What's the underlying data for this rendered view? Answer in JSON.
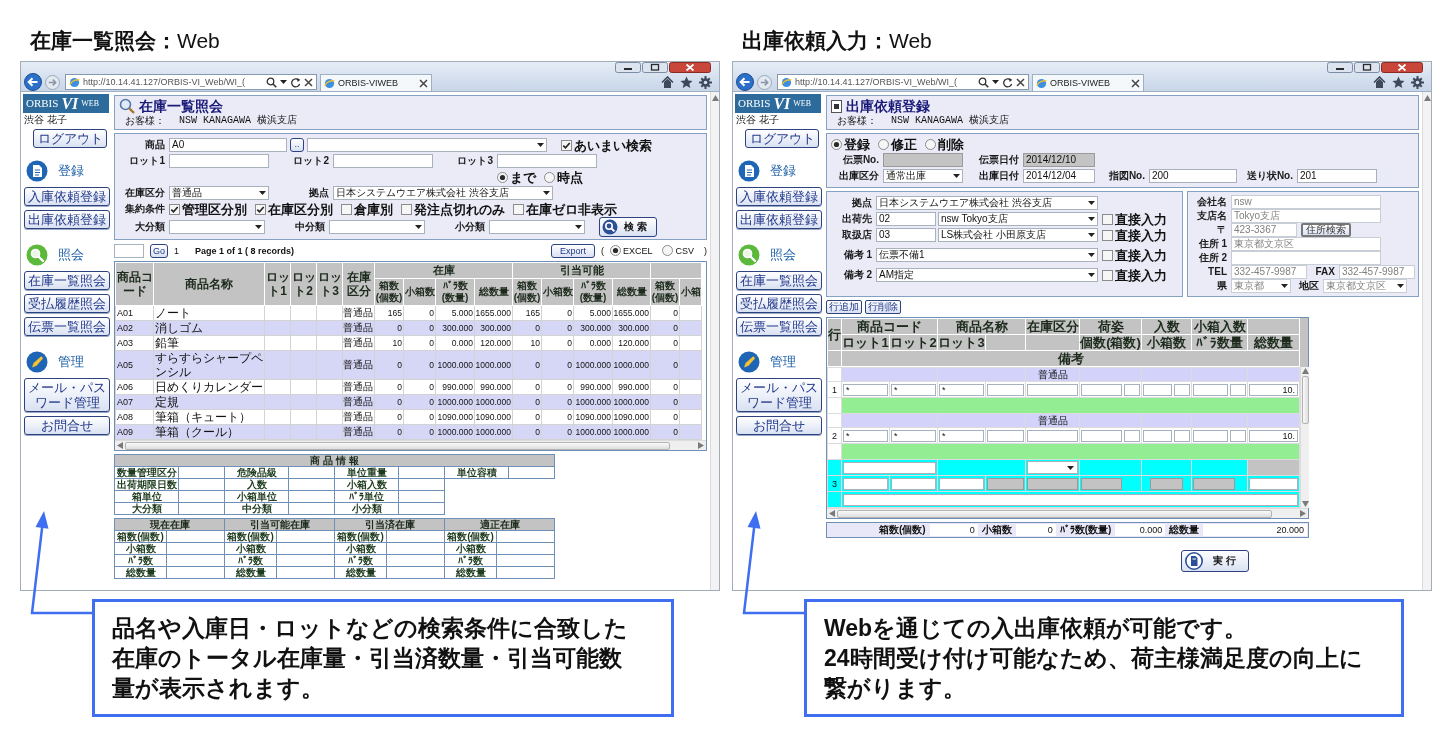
{
  "sections": [
    {
      "kind": "stock_inquiry",
      "heading": "**在庫一覧照会：**Web",
      "browser": {
        "address": "http://10.14.41.127/ORBIS-VI_Web/WI_(",
        "tab": "ORBIS-VIWEB"
      },
      "sidebar": {
        "logo": {
          "name": "ORBIS",
          "mark": "VI",
          "suffix": "WEB"
        },
        "user": "渋谷 花子",
        "logout": "ログアウト",
        "groups": [
          {
            "title": "登録",
            "items": [
              "入庫依頼登録",
              "出庫依頼登録"
            ]
          },
          {
            "title": "照会",
            "items": [
              "在庫一覧照会",
              "受払履歴照会",
              "伝票一覧照会"
            ]
          },
          {
            "title": "管理",
            "items": [
              "メール・パスワード管理",
              "お問合せ"
            ]
          }
        ]
      },
      "app": {
        "title": "在庫一覧照会",
        "customer_label": "お客様：",
        "customer": "NSW KANAGAWA 横浜支店",
        "search": {
          "product": {
            "label": "商品",
            "value": "A0",
            "lookup": ".."
          },
          "fuzzy": {
            "label": "あいまい検索",
            "checked": true
          },
          "lots": [
            "ロット1",
            "ロット2",
            "ロット3"
          ],
          "date_modes": [
            {
              "label": "まで",
              "selected": true
            },
            {
              "label": "時点",
              "selected": false
            }
          ],
          "stock_type": {
            "label": "在庫区分",
            "value": "普通品"
          },
          "site": {
            "label": "拠点",
            "value": "日本システムウエア株式会社 渋谷支店"
          },
          "grouping": {
            "label": "集約条件",
            "options": [
              {
                "label": "管理区分別",
                "checked": true
              },
              {
                "label": "在庫区分別",
                "checked": true
              },
              {
                "label": "倉庫別",
                "checked": false
              },
              {
                "label": "発注点切れのみ",
                "checked": false
              },
              {
                "label": "在庫ゼロ非表示",
                "checked": false
              }
            ]
          },
          "categories": [
            "大分類",
            "中分類",
            "小分類"
          ],
          "button": "検 索"
        },
        "pager": {
          "go": "Go",
          "page": "1",
          "summary": "Page 1 of 1 ( 8 records)",
          "export": "Export",
          "open": "(",
          "formats": [
            {
              "label": "EXCEL",
              "selected": true
            },
            {
              "label": "CSV",
              "selected": false
            }
          ],
          "close": ")"
        },
        "table": {
          "columns": [
            "商品コード",
            "商品名称",
            "ロット1",
            "ロット2",
            "ロット3",
            "在庫区分"
          ],
          "groups": [
            {
              "title": "在庫",
              "columns": [
                "箱数(個数)",
                "小箱数",
                "ﾊﾞﾗ数(数量)",
                "総数量"
              ]
            },
            {
              "title": "引当可能",
              "columns": [
                "箱数(個数)",
                "小箱数",
                "ﾊﾞﾗ数(数量)",
                "総数量"
              ]
            },
            {
              "columns": [
                "箱数(個数)",
                "小箱"
              ]
            }
          ],
          "rows": [
            {
              "code": "A01",
              "name": "ノート",
              "type": "普通品",
              "values": [
                "165",
                "0",
                "5.000",
                "1655.000",
                "165",
                "0",
                "5.000",
                "1655.000",
                "0"
              ]
            },
            {
              "code": "A02",
              "name": "消しゴム",
              "type": "普通品",
              "values": [
                "0",
                "0",
                "300.000",
                "300.000",
                "0",
                "0",
                "300.000",
                "300.000",
                "0"
              ]
            },
            {
              "code": "A03",
              "name": "鉛筆",
              "type": "普通品",
              "values": [
                "10",
                "0",
                "0.000",
                "120.000",
                "10",
                "0",
                "0.000",
                "120.000",
                "0"
              ]
            },
            {
              "code": "A05",
              "name": "すらすらシャープペンシル",
              "type": "普通品",
              "values": [
                "0",
                "0",
                "1000.000",
                "1000.000",
                "0",
                "0",
                "1000.000",
                "1000.000",
                "0"
              ]
            },
            {
              "code": "A06",
              "name": "日めくりカレンダー",
              "type": "普通品",
              "values": [
                "0",
                "0",
                "990.000",
                "990.000",
                "0",
                "0",
                "990.000",
                "990.000",
                "0"
              ]
            },
            {
              "code": "A07",
              "name": "定規",
              "type": "普通品",
              "values": [
                "0",
                "0",
                "1000.000",
                "1000.000",
                "0",
                "0",
                "1000.000",
                "1000.000",
                "0"
              ]
            },
            {
              "code": "A08",
              "name": "筆箱（キュート）",
              "type": "普通品",
              "values": [
                "0",
                "0",
                "1090.000",
                "1090.000",
                "0",
                "0",
                "1090.000",
                "1090.000",
                "0"
              ]
            },
            {
              "code": "A09",
              "name": "筆箱（クール）",
              "type": "普通品",
              "values": [
                "0",
                "0",
                "1000.000",
                "1000.000",
                "0",
                "0",
                "1000.000",
                "1000.000",
                "0"
              ]
            }
          ]
        },
        "product_info": {
          "title": "商 品 情 報",
          "rows": [
            [
              "数量管理区分",
              "危険品級",
              "単位重量",
              "単位容積"
            ],
            [
              "出荷期限日数",
              "入数",
              "小箱入数"
            ],
            [
              "箱単位",
              "小箱単位",
              "ﾊﾞﾗ単位"
            ],
            [
              "大分類",
              "中分類",
              "小分類"
            ]
          ]
        },
        "stock_summary": [
          {
            "title": "現在在庫",
            "rows": [
              "箱数(個数)",
              "小箱数",
              "ﾊﾞﾗ数",
              "総数量"
            ]
          },
          {
            "title": "引当可能在庫",
            "rows": [
              "箱数(個数)",
              "小箱数",
              "ﾊﾞﾗ数",
              "総数量"
            ]
          },
          {
            "title": "引当済在庫",
            "rows": [
              "箱数(個数)",
              "小箱数",
              "ﾊﾞﾗ数",
              "総数量"
            ]
          },
          {
            "title": "適正在庫",
            "rows": [
              "箱数(個数)",
              "小箱数",
              "ﾊﾞﾗ数",
              "総数量"
            ]
          }
        ]
      },
      "callout": {
        "paragraphs": [
          "品名や入庫日・ロットなどの検索条件に合致した在庫のトータル在庫量・引当済数量・引当可能数量が表示されます。"
        ]
      }
    },
    {
      "kind": "shipping_request",
      "heading": "**出庫依頼入力：**Web",
      "browser": {
        "address": "http://10.14.41.127/ORBIS-VI_Web/WI_(",
        "tab": "ORBIS-VIWEB"
      },
      "sidebar": {
        "logo": {
          "name": "ORBIS",
          "mark": "VI",
          "suffix": "WEB"
        },
        "user": "渋谷 花子",
        "logout": "ログアウト",
        "groups": [
          {
            "title": "登録",
            "items": [
              "入庫依頼登録",
              "出庫依頼登録"
            ]
          },
          {
            "title": "照会",
            "items": [
              "在庫一覧照会",
              "受払履歴照会",
              "伝票一覧照会"
            ]
          },
          {
            "title": "管理",
            "items": [
              "メール・パスワード管理",
              "お問合せ"
            ]
          }
        ]
      },
      "app": {
        "title": "出庫依頼登録",
        "customer_label": "お客様：",
        "customer": "NSW KANAGAWA 横浜支店",
        "modes": [
          {
            "label": "登録",
            "selected": true
          },
          {
            "label": "修正",
            "selected": false
          },
          {
            "label": "削除",
            "selected": false
          }
        ],
        "header_rows": [
          [
            {
              "label": "伝票No.",
              "kind": "input",
              "readonly": true
            },
            {
              "label": "伝票日付",
              "kind": "input",
              "value": "2014/12/10",
              "readonly": true
            }
          ],
          [
            {
              "label": "出庫区分",
              "kind": "select",
              "value": "通常出庫",
              "readonly": false
            },
            {
              "label": "出庫日付",
              "kind": "input",
              "value": "2014/12/04",
              "readonly": false
            },
            {
              "label": "指図No.",
              "kind": "input",
              "value": "200",
              "readonly": false
            },
            {
              "label": "送り状No.",
              "kind": "input",
              "value": "201",
              "readonly": false
            }
          ]
        ],
        "delivery": {
          "site": {
            "label": "拠点",
            "value": "日本システムウエア株式会社 渋谷支店"
          },
          "rows": [
            {
              "label": "出荷先",
              "code": "02",
              "value": "nsw Tokyo支店",
              "direct": {
                "label": "直接入力",
                "checked": false
              }
            },
            {
              "label": "取扱店",
              "code": "03",
              "value": "LS株式会社 小田原支店",
              "direct": {
                "label": "直接入力",
                "checked": false
              }
            },
            {
              "label": "備考 1",
              "value": "伝票不備1",
              "direct": {
                "label": "直接入力",
                "checked": false
              }
            },
            {
              "label": "備考 2",
              "value": "AM指定",
              "direct": {
                "label": "直接入力",
                "checked": false
              }
            }
          ]
        },
        "address": {
          "rows": [
            [
              {
                "label": "会社名",
                "kind": "input",
                "value": "nsw",
                "disabled": true
              }
            ],
            [
              {
                "label": "支店名",
                "kind": "input",
                "value": "Tokyo支店",
                "disabled": true
              }
            ],
            [
              {
                "label": "〒",
                "kind": "input",
                "value": "423-3367",
                "disabled": true,
                "button": "住所検索"
              }
            ],
            [
              {
                "label": "住所 1",
                "kind": "input",
                "value": "東京都文京区",
                "disabled": true
              }
            ],
            [
              {
                "label": "住所 2",
                "kind": "input",
                "disabled": true
              }
            ],
            [
              {
                "label": "TEL",
                "kind": "input",
                "value": "332-457-9987",
                "disabled": true
              },
              {
                "label": "FAX",
                "kind": "input",
                "value": "332-457-9987",
                "disabled": true
              }
            ],
            [
              {
                "label": "県",
                "kind": "select",
                "value": "東京都",
                "disabled": true
              },
              {
                "label": "地区",
                "kind": "select",
                "value": "東京都文京区",
                "disabled": true
              }
            ]
          ]
        },
        "line_buttons": [
          "行追加",
          "行削除"
        ],
        "grid": {
          "row_header": "行",
          "top_headers": [
            "商品コード",
            "商品名称",
            "在庫区分",
            "荷姿",
            "入数",
            "小箱入数"
          ],
          "bottom_headers": [
            "ロット1",
            "ロット2",
            "ロット3",
            "個数(箱数)",
            "小箱数",
            "ﾊﾞﾗ数量",
            "総数量"
          ],
          "note_header": "備考",
          "lines": [
            {
              "number": "1",
              "category": "普通品",
              "codes": [
                "*",
                "*",
                "*"
              ],
              "total": "10.",
              "selected": false
            },
            {
              "number": "2",
              "category": "普通品",
              "codes": [
                "*",
                "*",
                "*"
              ],
              "total": "10.",
              "selected": false
            },
            {
              "number": "3",
              "selected": true
            }
          ]
        },
        "totals": [
          {
            "label": "箱数(個数)",
            "value": "0"
          },
          {
            "label": "小箱数",
            "value": "0"
          },
          {
            "label": "ﾊﾞﾗ数(数量)",
            "value": "0.000"
          },
          {
            "label": "総数量",
            "value": "20.000"
          }
        ],
        "execute": "実 行"
      },
      "callout": {
        "paragraphs": [
          "Webを通じての入出庫依頼が可能です。",
          "24時間受け付け可能なため、荷主様満足度の向上に繋がります。"
        ]
      }
    }
  ]
}
